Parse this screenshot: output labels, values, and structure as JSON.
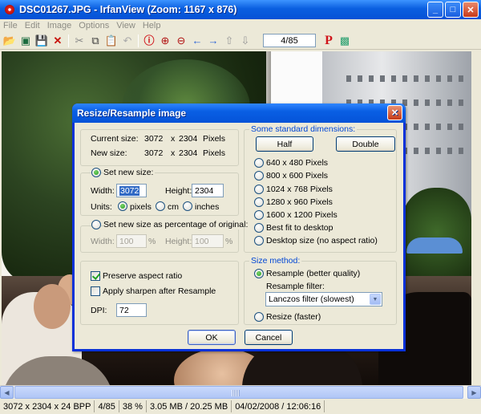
{
  "window": {
    "title": "DSC01267.JPG - IrfanView (Zoom: 1167 x 876)",
    "controls": [
      "_",
      "□",
      "✕"
    ]
  },
  "menu": [
    "File",
    "Edit",
    "Image",
    "Options",
    "View",
    "Help"
  ],
  "toolbar": {
    "icons": [
      "open-folder-icon",
      "slideshow-icon",
      "save-icon",
      "delete-icon",
      "cut-icon",
      "copy-icon",
      "paste-icon",
      "undo-icon",
      "info-icon",
      "zoom-in-icon",
      "zoom-out-icon",
      "previous-icon",
      "next-icon",
      "first-icon",
      "last-icon"
    ],
    "page_counter": "4/85",
    "print_label": "P"
  },
  "status": {
    "dimensions": "3072 x 2304 x 24 BPP",
    "position": "4/85",
    "zoom": "38 %",
    "memory": "3.05 MB / 20.25 MB",
    "datetime": "04/02/2008 / 12:06:16"
  },
  "dialog": {
    "title": "Resize/Resample image",
    "close": "✕",
    "current_size": {
      "label": "Current size:",
      "w": "3072",
      "x": "x",
      "h": "2304",
      "unit": "Pixels"
    },
    "new_size": {
      "label": "New size:",
      "w": "3072",
      "x": "x",
      "h": "2304",
      "unit": "Pixels"
    },
    "set_new_size": {
      "legend": "Set new size:",
      "width_label": "Width:",
      "width_value": "3072",
      "height_label": "Height:",
      "height_value": "2304",
      "units_label": "Units:",
      "units": [
        "pixels",
        "cm",
        "inches"
      ],
      "selected_unit": "pixels"
    },
    "percentage": {
      "legend": "Set new size as percentage of original:",
      "width_label": "Width:",
      "width_value": "100",
      "height_label": "Height:",
      "height_value": "100",
      "percent": "%"
    },
    "options": {
      "preserve_aspect": "Preserve aspect ratio",
      "preserve_aspect_checked": true,
      "sharpen": "Apply sharpen after Resample",
      "sharpen_checked": false,
      "dpi_label": "DPI:",
      "dpi_value": "72"
    },
    "standard": {
      "legend": "Some standard dimensions:",
      "half": "Half",
      "double": "Double",
      "sizes": [
        "640 x 480 Pixels",
        "800 x 600 Pixels",
        "1024 x 768 Pixels",
        "1280 x 960 Pixels",
        "1600 x 1200 Pixels",
        "Best fit to desktop",
        "Desktop size (no aspect ratio)"
      ]
    },
    "method": {
      "legend": "Size method:",
      "resample": "Resample (better quality)",
      "filter_label": "Resample filter:",
      "filter_value": "Lanczos filter (slowest)",
      "resize": "Resize (faster)",
      "selected": "resample"
    },
    "ok": "OK",
    "cancel": "Cancel"
  }
}
